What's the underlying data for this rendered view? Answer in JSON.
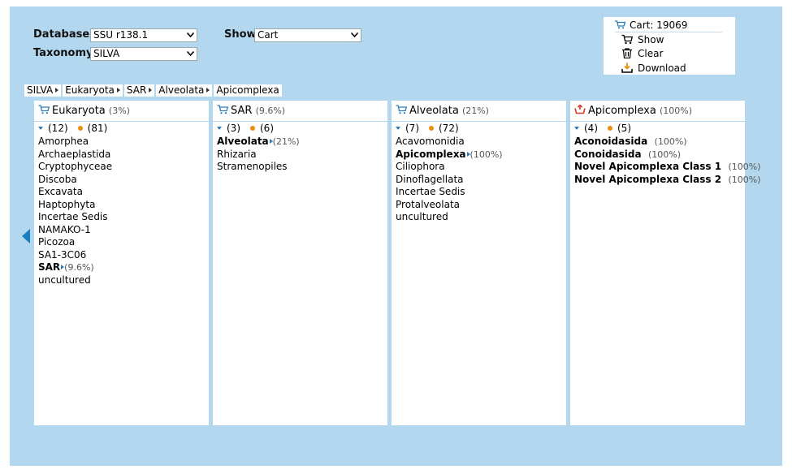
{
  "controls": {
    "database_label": "Database",
    "database_value": "SSU r138.1",
    "taxonomy_label": "Taxonomy",
    "taxonomy_value": "SILVA",
    "show_label": "Show",
    "show_value": "Cart"
  },
  "cart": {
    "title": "Cart: 19069",
    "show": "Show",
    "clear": "Clear",
    "download": "Download"
  },
  "breadcrumbs": [
    "SILVA",
    "Eukaryota",
    "SAR",
    "Alveolata",
    "Apicomplexa"
  ],
  "columns": [
    {
      "title": "Eukaryota",
      "pct": "(3%)",
      "icon": "cart-icon",
      "count_children": "(12)",
      "count_leaves": "(81)",
      "items": [
        {
          "label": "Amorphea"
        },
        {
          "label": "Archaeplastida"
        },
        {
          "label": "Cryptophyceae"
        },
        {
          "label": "Discoba"
        },
        {
          "label": "Excavata"
        },
        {
          "label": "Haptophyta"
        },
        {
          "label": "Incertae Sedis"
        },
        {
          "label": "NAMAKO-1"
        },
        {
          "label": "Picozoa"
        },
        {
          "label": "SA1-3C06"
        },
        {
          "label": "SAR",
          "pct": "(9.6%)",
          "selected": true
        },
        {
          "label": "uncultured"
        }
      ]
    },
    {
      "title": "SAR",
      "pct": "(9.6%)",
      "icon": "cart-icon",
      "count_children": "(3)",
      "count_leaves": "(6)",
      "items": [
        {
          "label": "Alveolata",
          "pct": "(21%)",
          "selected": true
        },
        {
          "label": "Rhizaria"
        },
        {
          "label": "Stramenopiles"
        }
      ]
    },
    {
      "title": "Alveolata",
      "pct": "(21%)",
      "icon": "cart-icon",
      "count_children": "(7)",
      "count_leaves": "(72)",
      "items": [
        {
          "label": "Acavomonidia"
        },
        {
          "label": "Apicomplexa",
          "pct": "(100%)",
          "selected": true
        },
        {
          "label": "Ciliophora"
        },
        {
          "label": "Dinoflagellata"
        },
        {
          "label": "Incertae Sedis"
        },
        {
          "label": "Protalveolata"
        },
        {
          "label": "uncultured"
        }
      ]
    },
    {
      "title": "Apicomplexa",
      "pct": "(100%)",
      "icon": "cart-remove-icon",
      "count_children": "(4)",
      "count_leaves": "(5)",
      "items": [
        {
          "label": "Aconoidasida",
          "pct": "(100%)",
          "in_cart": true
        },
        {
          "label": "Conoidasida",
          "pct": "(100%)",
          "in_cart": true
        },
        {
          "label": "Novel Apicomplexa Class 1",
          "pct": "(100%)",
          "in_cart": true
        },
        {
          "label": "Novel Apicomplexa Class 2",
          "pct": "(100%)",
          "in_cart": true
        }
      ]
    }
  ],
  "colors": {
    "panel_bg": "#b3d7ee",
    "accent_blue": "#2c7bb6",
    "dot_orange": "#e8900c",
    "remove_red": "#d63a2a"
  }
}
